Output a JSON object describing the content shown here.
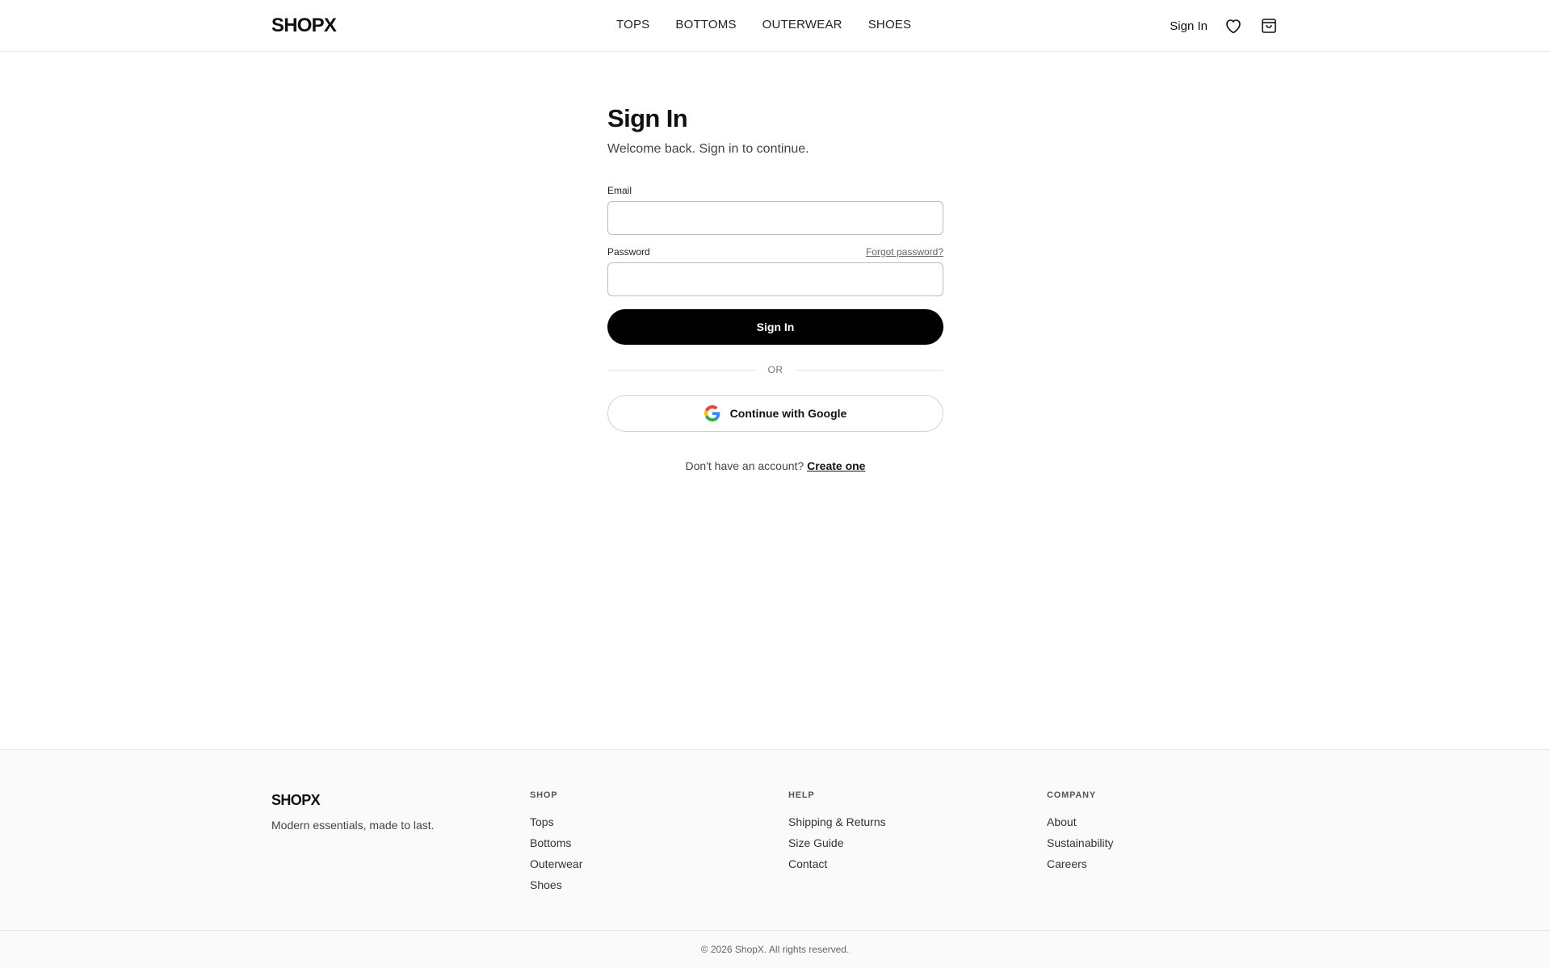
{
  "brand": "SHOPX",
  "nav": {
    "items": [
      "TOPS",
      "BOTTOMS",
      "OUTERWEAR",
      "SHOES"
    ],
    "sign_in": "Sign In"
  },
  "icons": {
    "wishlist": "heart-icon",
    "cart": "shopping-bag-icon",
    "google": "google-g-icon"
  },
  "form": {
    "title": "Sign In",
    "subtitle": "Welcome back. Sign in to continue.",
    "email_label": "Email",
    "email_value": "",
    "password_label": "Password",
    "password_value": "",
    "forgot_label": "Forgot password?",
    "submit_label": "Sign In",
    "divider": "OR",
    "google_label": "Continue with Google",
    "signup_prompt": "Don't have an account?",
    "signup_link": "Create one"
  },
  "footer": {
    "logo": "SHOPX",
    "tagline": "Modern essentials, made to last.",
    "columns": [
      {
        "heading": "SHOP",
        "links": [
          "Tops",
          "Bottoms",
          "Outerwear",
          "Shoes"
        ]
      },
      {
        "heading": "HELP",
        "links": [
          "Shipping & Returns",
          "Size Guide",
          "Contact"
        ]
      },
      {
        "heading": "COMPANY",
        "links": [
          "About",
          "Sustainability",
          "Careers"
        ]
      }
    ],
    "copyright": "© 2026 ShopX. All rights reserved."
  },
  "colors": {
    "primary": "#000000",
    "text": "#111111",
    "border": "#e5e5e5",
    "footer_bg": "#fafafa",
    "google_blue": "#4285F4",
    "google_red": "#EA4335",
    "google_yellow": "#FBBC05",
    "google_green": "#34A853"
  }
}
